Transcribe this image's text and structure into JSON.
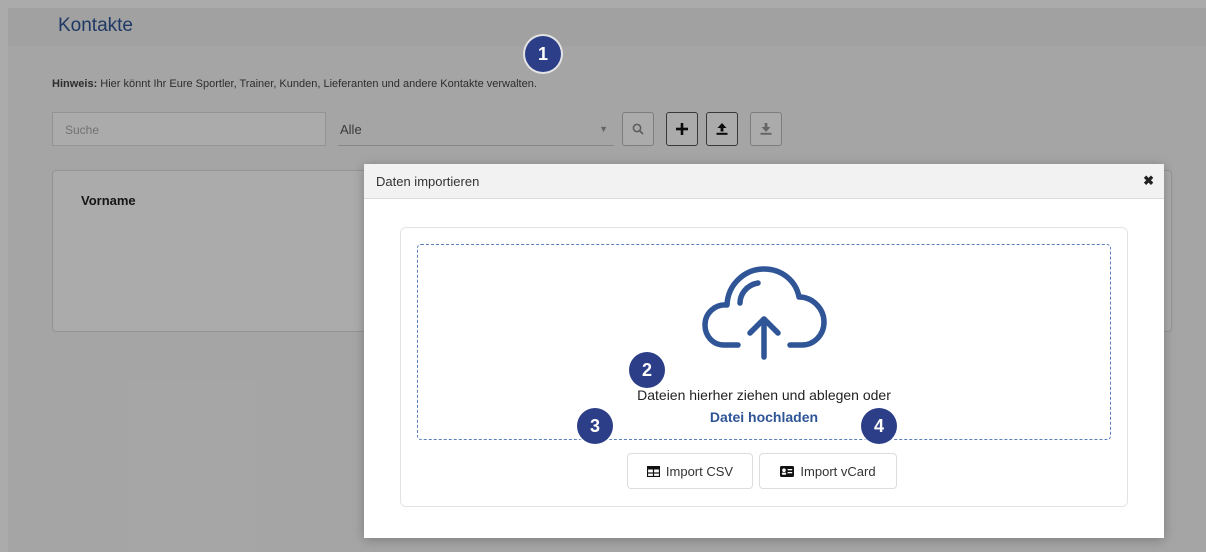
{
  "page": {
    "title": "Kontakte",
    "hint_label": "Hinweis:",
    "hint_text": " Hier könnt Ihr Eure Sportler, Trainer, Kunden, Lieferanten und andere Kontakte verwalten.",
    "search_placeholder": "Suche",
    "filter_value": "Alle",
    "table_header_first": "Vorname"
  },
  "modal": {
    "title": "Daten importieren",
    "close": "✖",
    "drop_text": "Dateien hierher ziehen und ablegen oder",
    "upload_link": "Datei hochladen",
    "import_csv": "Import CSV",
    "import_vcard": "Import vCard"
  },
  "badges": [
    "1",
    "2",
    "3",
    "4"
  ],
  "colors": {
    "accent": "#2f5597",
    "badge": "#2c3e87"
  }
}
